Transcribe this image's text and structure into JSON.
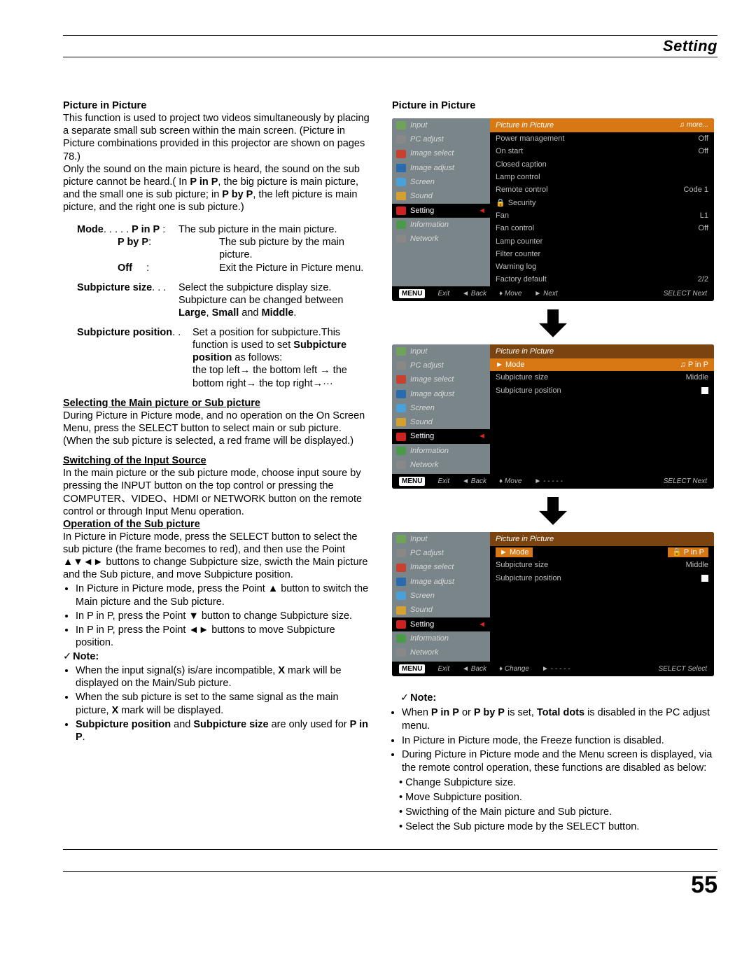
{
  "header": {
    "title": "Setting"
  },
  "page_number": "55",
  "left": {
    "pip_heading": "Picture in Picture",
    "intro": "This function is used to project two videos simultaneously by placing a separate small sub screen within the main screen. (Picture in Picture combinations provided in this projector are shown on pages 78.)",
    "intro2a": "Only the sound on the main picture is heard, the sound on the sub picture cannot be heard.( In ",
    "intro2_pinp": "P in P",
    "intro2b": ", the big picture is main picture, and the small one is sub picture; in ",
    "intro2_pbyp": "P by P",
    "intro2c": ", the left picture is main picture, and the right one is sub picture.)",
    "mode_label": "Mode",
    "mode_pinp_l": "P in P",
    "mode_pinp_v": "The sub picture in the main picture.",
    "mode_pbyp_l": "P by P",
    "mode_pbyp_v": "The sub picture by the main picture.",
    "mode_off_l": "Off",
    "mode_off_v": "Exit the Picture in Picture menu.",
    "subsize_label": "Subpicture size",
    "subsize_v1": "Select the subpicture display size. Subpicture can be changed between ",
    "subsize_large": "Large",
    "subsize_small": "Small",
    "subsize_middle": "Middle",
    "subpos_label": "Subpicture position",
    "subpos_v1": "Set a position for subpicture.This function is used to set ",
    "subpos_bold": "Subpicture position",
    "subpos_v2": " as follows:",
    "subpos_seq": "the top left→ the bottom left → the bottom right→ the top right→···",
    "sel_heading": "Selecting the Main picture or Sub picture",
    "sel_body": "During Picture in Picture mode, and no operation on the On Screen Menu, press the SELECT button to select main or sub picture. (When the sub picture is selected,  a red frame will be displayed.)",
    "switch_heading": "Switching of the Input Source",
    "switch_body": "In the main picture or the sub picture mode, choose input soure by pressing the INPUT button on the top control or pressing the COMPUTER、VIDEO、HDMI or NETWORK button on the remote control or through Input Menu operation.",
    "op_heading": "Operation of the Sub picture",
    "op_body": "In Picture in Picture mode, press the SELECT  button to select the sub picture (the frame becomes to  red), and then use the Point ▲▼◄► buttons to change Subpicture size, swicth the Main picture and the Sub picture, and move Subpicture position.",
    "op_b1": "In Picture in Picture mode, press the Point ▲ button to switch the Main picture and the Sub picture.",
    "op_b2": "In P in P,  press the Point ▼ button to change Subpicture size.",
    "op_b3": "In P in P,  press the Point ◄► buttons to move Subpicture position.",
    "note": "Note:",
    "n1a": "When the input signal(s) is/are incompatible, ",
    "n1x": "X",
    "n1b": " mark will be displayed on the Main/Sub picture.",
    "n2a": "When the sub picture is set to the same signal as the main picture, ",
    "n2b": " mark will be displayed.",
    "n3a": "Subpicture position",
    "n3mid": " and ",
    "n3b": "Subpicture size",
    "n3c": " are only used for ",
    "n3d": "P in P",
    "n3e": "."
  },
  "right": {
    "pip_heading": "Picture in Picture",
    "note": "Note:",
    "rn1a": "When ",
    "rn1b": "P in P",
    "rn1c": " or ",
    "rn1d": "P by P",
    "rn1e": " is set, ",
    "rn1f": "Total dots",
    "rn1g": " is disabled in the PC adjust menu.",
    "rn2": "In Picture in Picture mode, the Freeze function is disabled.",
    "rn3": "During Picture in Picture mode and the Menu screen is displayed, via the remote control operation, these functions are disabled as below:",
    "rn3a": "Change Subpicture size.",
    "rn3b": "Move Subpicture position.",
    "rn3c": "Swicthing of the Main picture and Sub picture.",
    "rn3d": "Select the Sub picture mode by the SELECT button."
  },
  "osd": {
    "sidebar": [
      {
        "icon": "ic1",
        "label": "Input"
      },
      {
        "icon": "ic2",
        "label": "PC adjust"
      },
      {
        "icon": "ic3",
        "label": "Image select"
      },
      {
        "icon": "ic4",
        "label": "Image adjust"
      },
      {
        "icon": "ic5",
        "label": "Screen"
      },
      {
        "icon": "ic6",
        "label": "Sound"
      },
      {
        "icon": "ic7",
        "label": "Setting",
        "selected": true
      },
      {
        "icon": "ic8",
        "label": "Information"
      },
      {
        "icon": "ic9",
        "label": "Network"
      }
    ],
    "menu1": {
      "title": "Picture in Picture",
      "more": "more...",
      "items": [
        {
          "l": "Power management",
          "v": "Off"
        },
        {
          "l": "On start",
          "v": "Off"
        },
        {
          "l": "Closed caption",
          "v": ""
        },
        {
          "l": "Lamp control",
          "v": ""
        },
        {
          "l": "Remote control",
          "v": "Code 1"
        },
        {
          "l": "Security",
          "v": "",
          "lock": true
        },
        {
          "l": "Fan",
          "v": "L1"
        },
        {
          "l": "Fan control",
          "v": "Off"
        },
        {
          "l": "Lamp counter",
          "v": ""
        },
        {
          "l": "Filter counter",
          "v": ""
        },
        {
          "l": "Warning log",
          "v": ""
        },
        {
          "l": "Factory default",
          "v": "2/2"
        }
      ],
      "footer": [
        "MENU",
        "Exit",
        "◄ Back",
        "♦ Move",
        "► Next",
        "SELECT Next"
      ]
    },
    "menu2": {
      "title": "Picture in Picture",
      "items": [
        {
          "l": "Mode",
          "v": "P in P",
          "hi": true
        },
        {
          "l": "Subpicture size",
          "v": "Middle"
        },
        {
          "l": "Subpicture position",
          "v": "",
          "sq": true
        }
      ],
      "footer": [
        "MENU",
        "Exit",
        "◄ Back",
        "♦ Move",
        "► - - - - -",
        "SELECT Next"
      ]
    },
    "menu3": {
      "title": "Picture in Picture",
      "items": [
        {
          "l": "Mode",
          "v": "P in P",
          "hi": true,
          "lockv": true
        },
        {
          "l": "Subpicture size",
          "v": "Middle"
        },
        {
          "l": "Subpicture position",
          "v": "",
          "sq": true
        }
      ],
      "footer": [
        "MENU",
        "Exit",
        "◄ Back",
        "♦ Change",
        "► - - - - -",
        "SELECT Select"
      ]
    }
  }
}
